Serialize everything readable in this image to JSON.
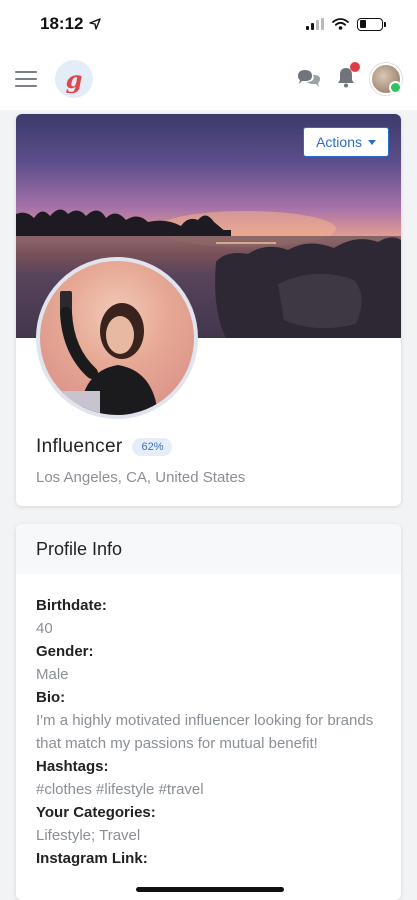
{
  "status_bar": {
    "time": "18:12"
  },
  "header": {
    "logo_letter": "g"
  },
  "profile": {
    "actions_label": "Actions",
    "name": "Influencer",
    "completion_badge": "62%",
    "location": "Los Angeles, CA, United States"
  },
  "profile_info": {
    "title": "Profile Info",
    "fields": [
      {
        "label": "Birthdate:",
        "value": "40"
      },
      {
        "label": "Gender:",
        "value": "Male"
      },
      {
        "label": "Bio:",
        "value": "I'm a highly motivated influencer looking for brands that match my passions for mutual benefit!"
      },
      {
        "label": "Hashtags:",
        "value": "#clothes #lifestyle #travel"
      },
      {
        "label": "Your Categories:",
        "value": "Lifestyle; Travel"
      },
      {
        "label": "Instagram Link:",
        "value": ""
      }
    ]
  },
  "colors": {
    "accent": "#2c6ccf",
    "notification": "#e23b45",
    "online": "#2ec45f"
  }
}
